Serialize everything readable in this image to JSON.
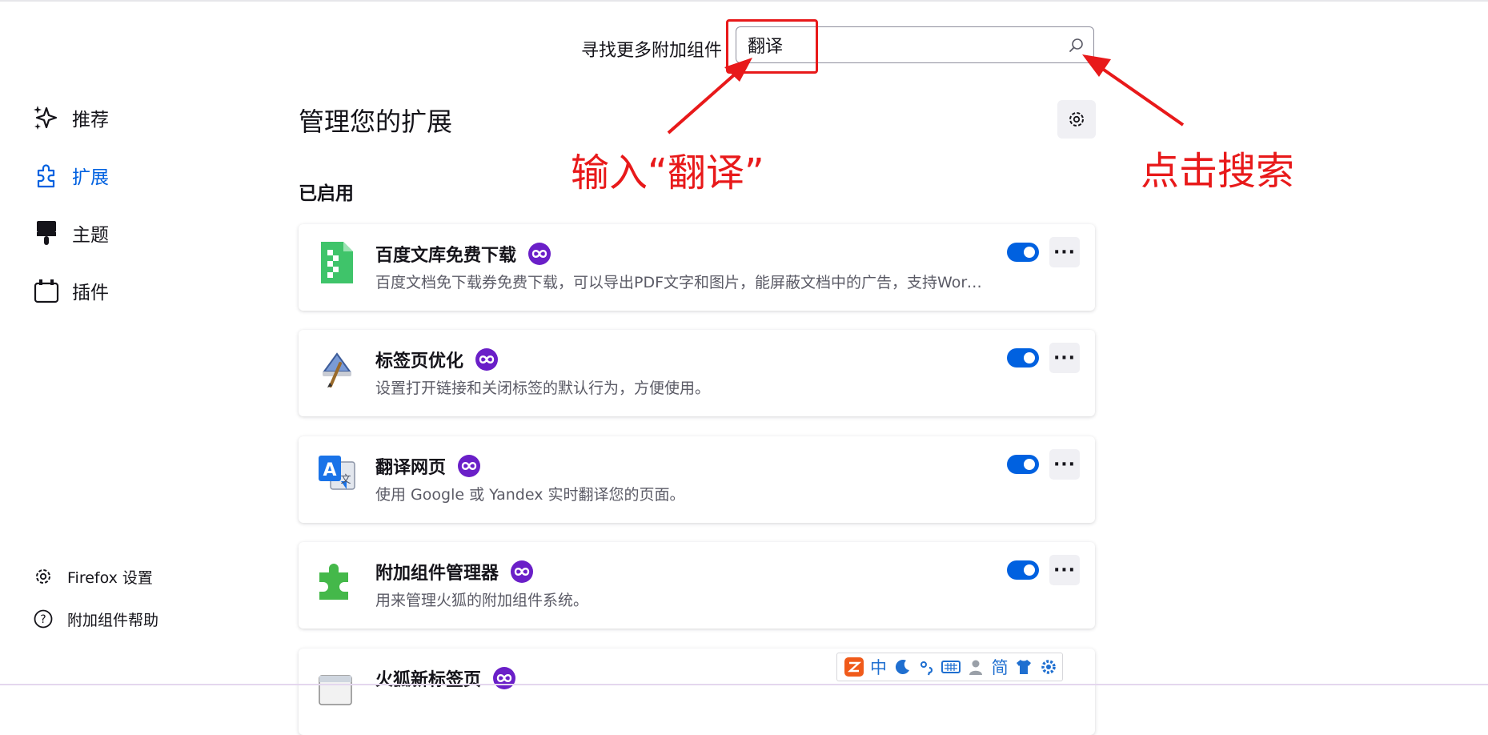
{
  "search": {
    "label": "寻找更多附加组件",
    "value": "翻译"
  },
  "sidebar": {
    "items": [
      {
        "label": "推荐",
        "icon": "sparkle-icon"
      },
      {
        "label": "扩展",
        "icon": "puzzle-icon",
        "active": true
      },
      {
        "label": "主题",
        "icon": "brush-icon"
      },
      {
        "label": "插件",
        "icon": "plugin-icon"
      }
    ],
    "footer": [
      {
        "label": "Firefox 设置",
        "icon": "gear-icon"
      },
      {
        "label": "附加组件帮助",
        "icon": "help-icon"
      }
    ]
  },
  "main": {
    "title": "管理您的扩展",
    "section": "已启用",
    "addons": [
      {
        "name": "百度文库免费下载",
        "description": "百度文档免下载券免费下载，可以导出PDF文字和图片，能屏蔽文档中的广告，支持Word、Excel",
        "enabled": true
      },
      {
        "name": "标签页优化",
        "description": "设置打开链接和关闭标签的默认行为，方便使用。",
        "enabled": true
      },
      {
        "name": "翻译网页",
        "description": "使用 Google 或 Yandex 实时翻译您的页面。",
        "enabled": true
      },
      {
        "name": "附加组件管理器",
        "description": "用来管理火狐的附加组件系统。",
        "enabled": true
      },
      {
        "name": "火狐新标签页",
        "description": "",
        "enabled": true
      }
    ],
    "more_label": "···"
  },
  "annotations": {
    "input_hint": "输入“翻译”",
    "click_hint": "点击搜索",
    "color": "#e8191a"
  },
  "ime_toolbar": {
    "mode": "中",
    "simplified": "简"
  },
  "colors": {
    "accent": "#0061e0",
    "badge": "#6a1fc8"
  }
}
